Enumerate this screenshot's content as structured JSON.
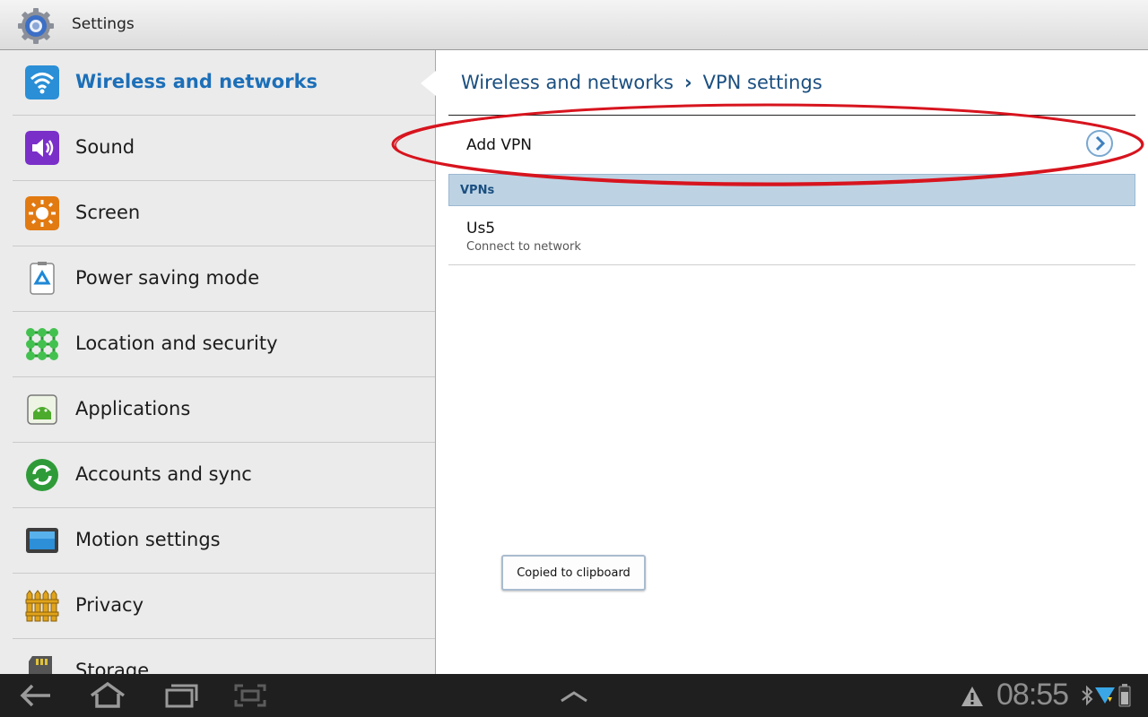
{
  "app": {
    "title": "Settings"
  },
  "sidebar": {
    "items": [
      {
        "label": "Wireless and networks",
        "icon": "wifi-icon",
        "active": true
      },
      {
        "label": "Sound",
        "icon": "speaker-icon"
      },
      {
        "label": "Screen",
        "icon": "brightness-icon"
      },
      {
        "label": "Power saving mode",
        "icon": "recycle-icon"
      },
      {
        "label": "Location and security",
        "icon": "pattern-lock-icon"
      },
      {
        "label": "Applications",
        "icon": "android-icon"
      },
      {
        "label": "Accounts and sync",
        "icon": "sync-icon"
      },
      {
        "label": "Motion settings",
        "icon": "tablet-icon"
      },
      {
        "label": "Privacy",
        "icon": "fence-icon"
      },
      {
        "label": "Storage",
        "icon": "sd-card-icon"
      }
    ]
  },
  "breadcrumb": {
    "parent": "Wireless and networks",
    "separator": "›",
    "current": "VPN settings"
  },
  "add_vpn": {
    "label": "Add VPN"
  },
  "vpns_section": {
    "header": "VPNs",
    "items": [
      {
        "name": "Us5",
        "status": "Connect to network"
      }
    ]
  },
  "toast": {
    "text": "Copied to clipboard"
  },
  "status_bar": {
    "time": "08:55"
  },
  "colors": {
    "accent": "#1c6fb8",
    "section_bg": "#bdd3e4",
    "highlight": "#d7141e"
  }
}
